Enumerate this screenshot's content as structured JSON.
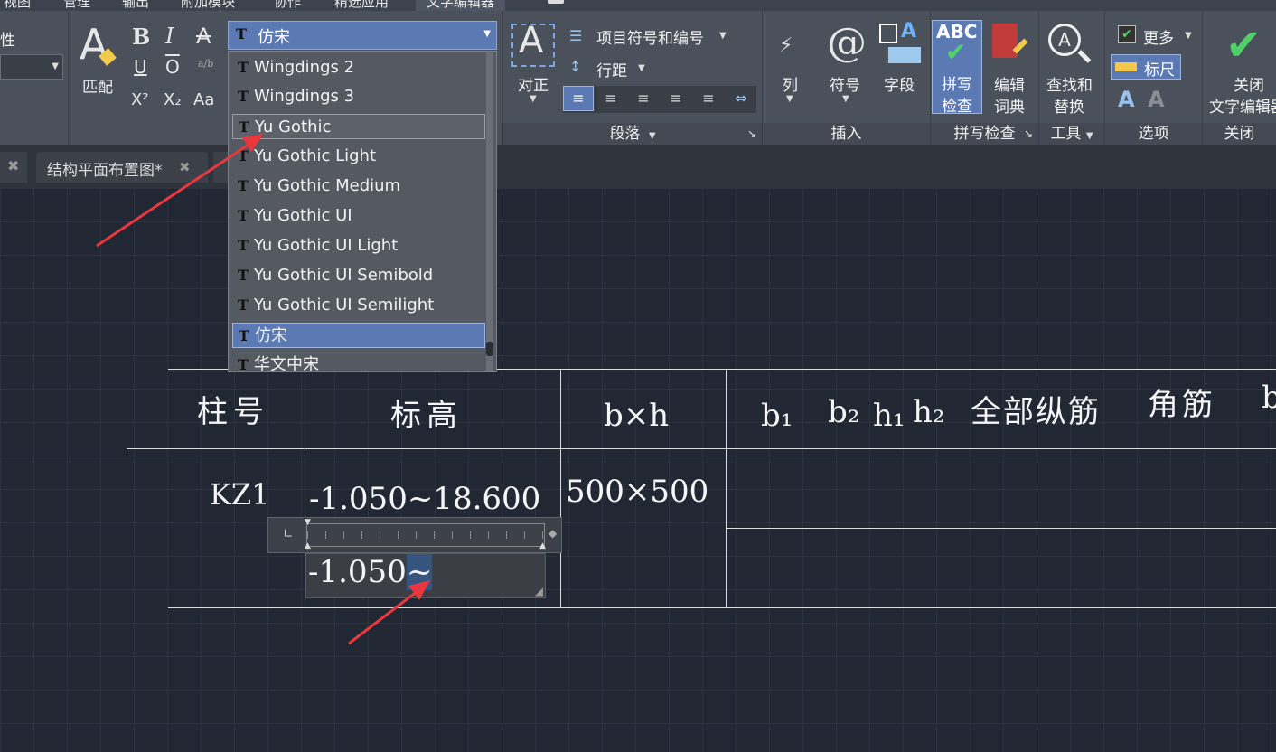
{
  "menu_tabs": [
    "视图",
    "管理",
    "输出",
    "附加模块",
    "协作",
    "精选应用",
    "文字编辑器"
  ],
  "ribbon": {
    "left_label": "性",
    "match_label": "匹配",
    "bold": "B",
    "italic": "I",
    "strike": "A",
    "underline": "U",
    "overline": "O",
    "stack": "a/b",
    "superscript": "X²",
    "subscript": "X₂",
    "case": "Aa",
    "justify_label": "对正",
    "bullets_label": "项目符号和编号",
    "line_spacing_label": "行距",
    "paragraph_panel": "段落",
    "columns_label": "列",
    "symbol_label": "符号",
    "field_label": "字段",
    "insert_panel": "插入",
    "spell_abc": "ABC",
    "spell_label1": "拼写",
    "spell_label2": "检查",
    "dict_label1": "编辑",
    "dict_label2": "词典",
    "spell_panel": "拼写检查",
    "find_label1": "查找和",
    "find_label2": "替换",
    "tools_panel": "工具",
    "more_label": "更多",
    "ruler_label": "标尺",
    "options_panel": "选项",
    "close_label1": "关闭",
    "close_label2": "文字编辑器",
    "close_panel": "关闭"
  },
  "font_combo": {
    "value": "仿宋"
  },
  "font_list": [
    "Wingdings 2",
    "Wingdings 3",
    "Yu Gothic",
    "Yu Gothic Light",
    "Yu Gothic Medium",
    "Yu Gothic UI",
    "Yu Gothic UI Light",
    "Yu Gothic UI Semibold",
    "Yu Gothic UI Semilight",
    "仿宋",
    "华文中宋"
  ],
  "font_list_state": {
    "hovered": "Yu Gothic",
    "selected": "仿宋"
  },
  "doc_tabs": [
    "结构平面布置图*"
  ],
  "table": {
    "headers": [
      "柱号",
      "标高",
      "b×h",
      "b₁",
      "b₂",
      "h₁",
      "h₂",
      "全部纵筋",
      "角筋",
      "b"
    ],
    "row": [
      "KZ1",
      "-1.050~18.600",
      "500×500"
    ]
  },
  "editor": {
    "text_before": "-1.050",
    "text_selected": "~"
  },
  "colors": {
    "accent": "#5b79b3",
    "canvas": "#212834",
    "arrow": "#e8383d",
    "ribbon": "#4b515b"
  }
}
